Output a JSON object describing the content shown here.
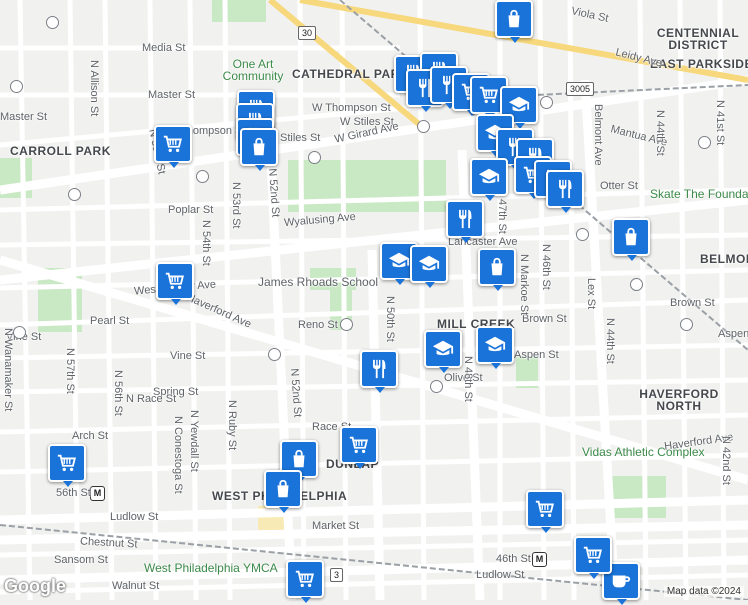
{
  "map": {
    "attribution": "Map data ©2024",
    "logo": "Google"
  },
  "places": {
    "poi": [
      {
        "name": "One Art Community"
      },
      {
        "name": "James Rhoads School"
      },
      {
        "name": "Vidas Athletic Complex"
      },
      {
        "name": "West Philadelphia YMCA"
      },
      {
        "name": "Skate The Foundation - West Phila"
      }
    ],
    "neighborhoods": [
      {
        "name": "CATHEDRAL PARK"
      },
      {
        "name": "CARROLL PARK"
      },
      {
        "name": "EAST PARKSIDE"
      },
      {
        "name": "CENTENNIAL DISTRICT"
      },
      {
        "name": "BELMONT"
      },
      {
        "name": "MILL CREEK"
      },
      {
        "name": "HAVERFORD NORTH"
      },
      {
        "name": "DUNLAP"
      },
      {
        "name": "WEST PHILADELPHIA"
      }
    ],
    "stations": [
      "56th St",
      "46th St"
    ],
    "route_shields": [
      "30",
      "3005",
      "3"
    ]
  },
  "streets": [
    "Media St",
    "Master St",
    "W Thompson St",
    "W Stiles St",
    "Stiles St",
    "Thompson St",
    "W Girard Ave",
    "Viola St",
    "Leidy Ave",
    "Mantua Ave",
    "Otter St",
    "Poplar St",
    "Wyalusing Ave",
    "Lancaster Ave",
    "Westminster Ave",
    "Brown St",
    "Pearl St",
    "Reno St",
    "Vine St",
    "Haverford Ave",
    "Aspen St",
    "Olive St",
    "Spring St",
    "N Race St",
    "Race St",
    "Arch St",
    "Ludlow St",
    "Market St",
    "Chestnut St",
    "Sansom St",
    "Walnut St",
    "N Allison St",
    "N 55th St",
    "N 53rd St",
    "N 54th St",
    "N 52nd St",
    "N 50th St",
    "N 48th St",
    "N 47th St",
    "N 46th St",
    "N Markoe St",
    "Lex St",
    "N 44th St",
    "N 42nd St",
    "N 41st St",
    "Belmont Ave",
    "N Wanamaker St",
    "N 57th St",
    "N 56th St",
    "N Conestoga St",
    "N Yewdall St",
    "N Ruby St"
  ],
  "markers": [
    {
      "type": "shopping-bag-icon",
      "glyph": "bag"
    },
    {
      "type": "restaurant-icon",
      "glyph": "food"
    },
    {
      "type": "grocery-cart-icon",
      "glyph": "cart"
    },
    {
      "type": "school-icon",
      "glyph": "school"
    },
    {
      "type": "cafe-icon",
      "glyph": "cup"
    }
  ],
  "colors": {
    "marker": "#1a73d9",
    "park": "#c9e8c4",
    "water": "#aadaff",
    "road": "#ffffff",
    "highway": "#f7d87c",
    "rail": "#9aa0a6"
  }
}
